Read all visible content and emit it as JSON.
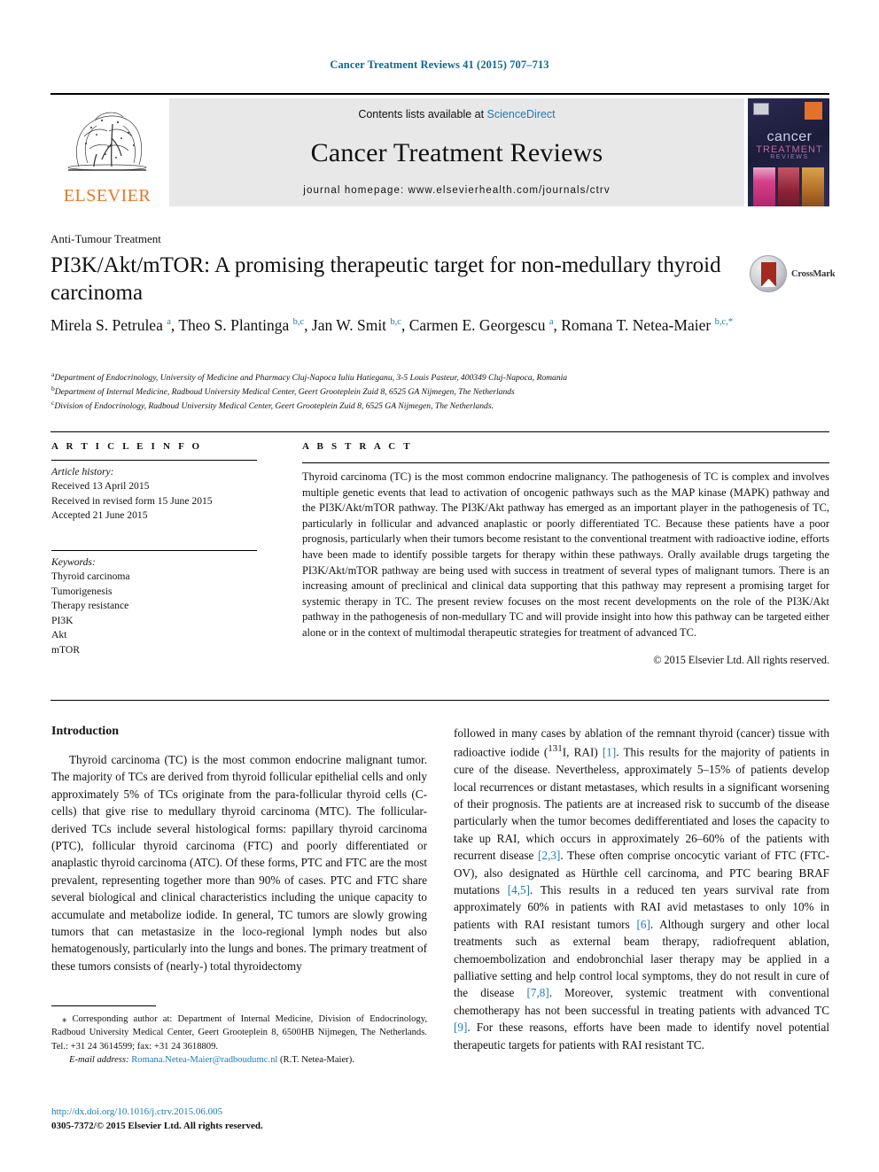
{
  "running_head": "Cancer Treatment Reviews 41 (2015) 707–713",
  "masthead": {
    "publisher_logo_label": "ELSEVIER",
    "contents_prefix": "Contents lists available at ",
    "contents_link": "ScienceDirect",
    "journal_title": "Cancer Treatment Reviews",
    "homepage": "journal homepage: www.elsevierhealth.com/journals/ctrv",
    "cover": {
      "line1": "cancer",
      "line2": "TREATMENT",
      "line3": "REVIEWS"
    }
  },
  "section_label": "Anti-Tumour Treatment",
  "title": "PI3K/Akt/mTOR: A promising therapeutic target for non-medullary thyroid carcinoma",
  "crossmark": {
    "label": "CrossMark"
  },
  "authors_html": "Mirela S. Petrulea <sup>a</sup>, Theo S. Plantinga <sup>b,c</sup>, Jan W. Smit <sup>b,c</sup>, Carmen E. Georgescu <sup>a</sup>, Romana T. Netea-Maier <sup>b,c,*</sup>",
  "affiliations": [
    {
      "marker": "a",
      "text": "Department of Endocrinology, University of Medicine and Pharmacy Cluj-Napoca Iuliu Hatieganu, 3-5 Louis Pasteur, 400349 Cluj-Napoca, Romania"
    },
    {
      "marker": "b",
      "text": "Department of Internal Medicine, Radboud University Medical Center, Geert Grooteplein Zuid 8, 6525 GA Nijmegen, The Netherlands"
    },
    {
      "marker": "c",
      "text": "Division of Endocrinology, Radboud University Medical Center, Geert Grooteplein Zuid 8, 6525 GA Nijmegen, The Netherlands."
    }
  ],
  "article_info": {
    "heading": "A R T I C L E    I N F O",
    "history_label": "Article history:",
    "history": [
      "Received 13 April 2015",
      "Received in revised form 15 June 2015",
      "Accepted 21 June 2015"
    ],
    "keywords_label": "Keywords:",
    "keywords": [
      "Thyroid carcinoma",
      "Tumorigenesis",
      "Therapy resistance",
      "PI3K",
      "Akt",
      "mTOR"
    ]
  },
  "abstract": {
    "heading": "A B S T R A C T",
    "text": "Thyroid carcinoma (TC) is the most common endocrine malignancy. The pathogenesis of TC is complex and involves multiple genetic events that lead to activation of oncogenic pathways such as the MAP kinase (MAPK) pathway and the PI3K/Akt/mTOR pathway. The PI3K/Akt pathway has emerged as an important player in the pathogenesis of TC, particularly in follicular and advanced anaplastic or poorly differentiated TC. Because these patients have a poor prognosis, particularly when their tumors become resistant to the conventional treatment with radioactive iodine, efforts have been made to identify possible targets for therapy within these pathways. Orally available drugs targeting the PI3K/Akt/mTOR pathway are being used with success in treatment of several types of malignant tumors. There is an increasing amount of preclinical and clinical data supporting that this pathway may represent a promising target for systemic therapy in TC. The present review focuses on the most recent developments on the role of the PI3K/Akt pathway in the pathogenesis of non-medullary TC and will provide insight into how this pathway can be targeted either alone or in the context of multimodal therapeutic strategies for treatment of advanced TC.",
    "rights": "© 2015 Elsevier Ltd. All rights reserved."
  },
  "body": {
    "intro_heading": "Introduction",
    "left_paragraph": "Thyroid carcinoma (TC) is the most common endocrine malignant tumor. The majority of TCs are derived from thyroid follicular epithelial cells and only approximately 5% of TCs originate from the para-follicular thyroid cells (C-cells) that give rise to medullary thyroid carcinoma (MTC). The follicular-derived TCs include several histological forms: papillary thyroid carcinoma (PTC), follicular thyroid carcinoma (FTC) and poorly differentiated or anaplastic thyroid carcinoma (ATC). Of these forms, PTC and FTC are the most prevalent, representing together more than 90% of cases. PTC and FTC share several biological and clinical characteristics including the unique capacity to accumulate and metabolize iodide. In general, TC tumors are slowly growing tumors that can metastasize in the loco-regional lymph nodes but also hematogenously, particularly into the lungs and bones. The primary treatment of these tumors consists of (nearly-) total thyroidectomy",
    "right_paragraph_segments": [
      {
        "type": "text",
        "value": "followed in many cases by ablation of the remnant thyroid (cancer) tissue with radioactive iodide ("
      },
      {
        "type": "sup",
        "value": "131"
      },
      {
        "type": "text",
        "value": "I, RAI) "
      },
      {
        "type": "ref",
        "value": "[1]"
      },
      {
        "type": "text",
        "value": ". This results for the majority of patients in cure of the disease. Nevertheless, approximately 5–15% of patients develop local recurrences or distant metastases, which results in a significant worsening of their prognosis. The patients are at increased risk to succumb of the disease particularly when the tumor becomes dedifferentiated and loses the capacity to take up RAI, which occurs in approximately 26–60% of the patients with recurrent disease "
      },
      {
        "type": "ref",
        "value": "[2,3]"
      },
      {
        "type": "text",
        "value": ". These often comprise oncocytic variant of FTC (FTC-OV), also designated as Hürthle cell carcinoma, and PTC bearing BRAF mutations "
      },
      {
        "type": "ref",
        "value": "[4,5]"
      },
      {
        "type": "text",
        "value": ". This results in a reduced ten years survival rate from approximately 60% in patients with RAI avid metastases to only 10% in patients with RAI resistant tumors "
      },
      {
        "type": "ref",
        "value": "[6]"
      },
      {
        "type": "text",
        "value": ". Although surgery and other local treatments such as external beam therapy, radiofrequent ablation, chemoembolization and endobronchial laser therapy may be applied in a palliative setting and help control local symptoms, they do not result in cure of the disease "
      },
      {
        "type": "ref",
        "value": "[7,8]"
      },
      {
        "type": "text",
        "value": ". Moreover, systemic treatment with conventional chemotherapy has not been successful in treating patients with advanced TC "
      },
      {
        "type": "ref",
        "value": "[9]"
      },
      {
        "type": "text",
        "value": ". For these reasons, efforts have been made to identify novel potential therapeutic targets for patients with RAI resistant TC."
      }
    ]
  },
  "footnote": {
    "corresponding": "⁎ Corresponding author at: Department of Internal Medicine, Division of Endocrinology, Radboud University Medical Center, Geert Grooteplein 8, 6500HB Nijmegen, The Netherlands. Tel.: +31 24 3614599; fax: +31 24 3618809.",
    "email_label": "E-mail address:",
    "email": "Romana.Netea-Maier@radboudumc.nl",
    "email_owner": "(R.T. Netea-Maier)."
  },
  "imprint": {
    "doi": "http://dx.doi.org/10.1016/j.ctrv.2015.06.005",
    "issn_rights": "0305-7372/© 2015 Elsevier Ltd. All rights reserved."
  },
  "colors": {
    "link": "#1a7bb9",
    "running_head": "#0b6a96",
    "elsevier_orange": "#E87722"
  }
}
